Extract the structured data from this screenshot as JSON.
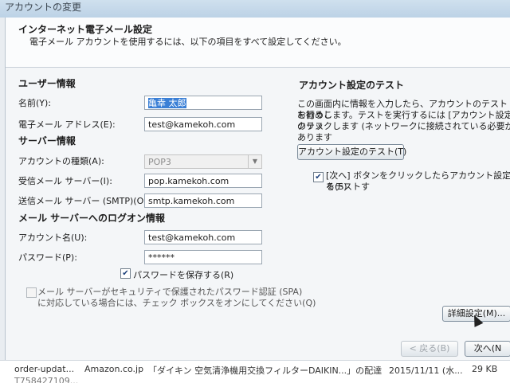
{
  "window": {
    "title": "アカウントの変更"
  },
  "header": {
    "title": "インターネット電子メール設定",
    "subtitle": "電子メール アカウントを使用するには、以下の項目をすべて設定してください。"
  },
  "user_info": {
    "heading": "ユーザー情報",
    "name_label": "名前(Y):",
    "name_value": "亀幸 太郎",
    "email_label": "電子メール アドレス(E):",
    "email_value": "test@kamekoh.com"
  },
  "server_info": {
    "heading": "サーバー情報",
    "account_type_label": "アカウントの種類(A):",
    "account_type_value": "POP3",
    "incoming_label": "受信メール サーバー(I):",
    "incoming_value": "pop.kamekoh.com",
    "outgoing_label": "送信メール サーバー (SMTP)(O):",
    "outgoing_value": "smtp.kamekoh.com"
  },
  "logon_info": {
    "heading": "メール サーバーへのログオン情報",
    "account_label": "アカウント名(U):",
    "account_value": "test@kamekoh.com",
    "password_label": "パスワード(P):",
    "password_value": "******",
    "remember_password": "パスワードを保存する(R)",
    "spa_line1": "メール サーバーがセキュリティで保護されたパスワード認証 (SPA)",
    "spa_line2": "に対応している場合には、チェック ボックスをオンにしてください(Q)"
  },
  "test_section": {
    "heading": "アカウント設定のテスト",
    "desc_line1": "この画面内に情報を入力したら、アカウントのテストを行うこ",
    "desc_line2": "お勧めします。テストを実行するには [アカウント設定のテス",
    "desc_line3": "クリックします (ネットワークに接続されている必要があります",
    "test_button": "アカウント設定のテスト(T)",
    "auto_test_line1": "[次へ] ボタンをクリックしたらアカウント設定をテストす",
    "auto_test_line2": "る(S)"
  },
  "buttons": {
    "more_settings": "詳細設定(M)...",
    "back": "< 戻る(B)",
    "next": "次へ(N"
  },
  "background_mail": {
    "sender": "order-updat...",
    "from": "Amazon.co.jp",
    "subject": "「ダイキン 空気清浄機用交換フィルターDAIKIN...」の配達",
    "date": "2015/11/11 (水...",
    "size": "29 KB",
    "row2": "T758427109..."
  },
  "colors": {
    "selection": "#3a7fd6",
    "checkmark": "#1b3f7a"
  }
}
